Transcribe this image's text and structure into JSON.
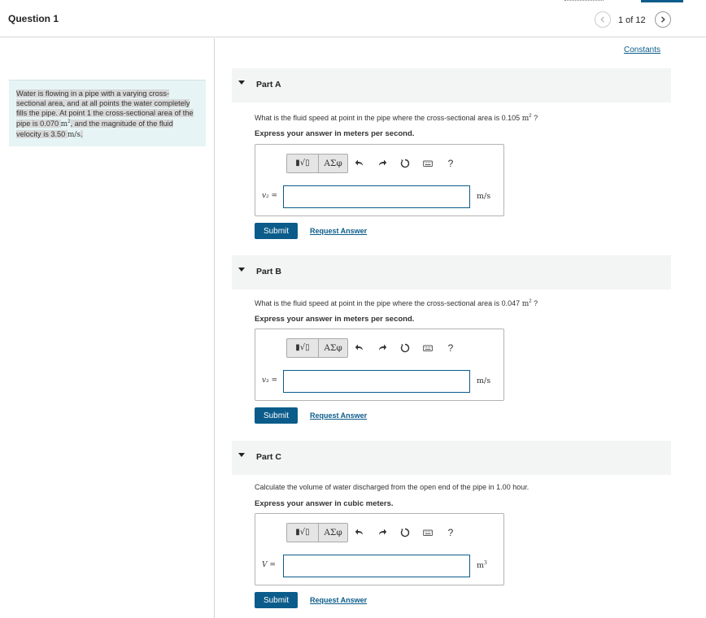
{
  "header": {
    "title": "Question 1",
    "pager": "1 of 12"
  },
  "problem": {
    "text_1": "Water is flowing in a pipe with a varying cross-sectional area, and at all points the water completely fills the pipe. At point 1 the cross-sectional area of the pipe is 0.070 ",
    "area_unit": "m",
    "text_2": ", and the magnitude of the fluid velocity is 3.50 ",
    "velocity_unit": "m/s",
    "text_3": "."
  },
  "constants_link": "Constants",
  "toolbar": {
    "templates_label": "▮√▯",
    "greek_label": "ΑΣφ",
    "help_label": "?"
  },
  "parts": [
    {
      "label": "Part A",
      "question": "What is the fluid speed at point in the pipe where the cross-sectional area is 0.105 ",
      "question_unit": "m",
      "question_tail": " ?",
      "express": "Express your answer in meters per second.",
      "var_label": "v₂ =",
      "input_value": "",
      "unit": "m/s",
      "submit": "Submit",
      "request": "Request Answer"
    },
    {
      "label": "Part B",
      "question": "What is the fluid speed at point in the pipe where the cross-sectional area is 0.047 ",
      "question_unit": "m",
      "question_tail": " ?",
      "express": "Express your answer in meters per second.",
      "var_label": "v₃ =",
      "input_value": "",
      "unit": "m/s",
      "submit": "Submit",
      "request": "Request Answer"
    },
    {
      "label": "Part C",
      "question": "Calculate the volume of water discharged from the open end of the pipe in 1.00 hour.",
      "express": "Express your answer in cubic meters.",
      "var_label": "V =",
      "input_value": "",
      "unit": "m",
      "submit": "Submit",
      "request": "Request Answer"
    }
  ],
  "colors": {
    "accent": "#0b5c8a",
    "problem_bg": "#e6f4f5",
    "part_header_bg": "#f3f4f4"
  }
}
